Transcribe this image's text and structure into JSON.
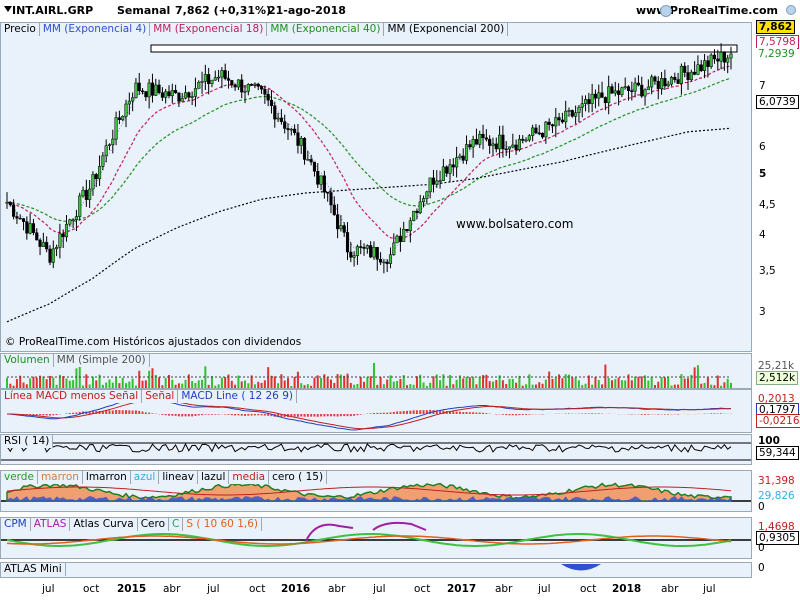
{
  "header": {
    "ticker": "INT.AIRL.GRP",
    "period": "Semanal",
    "quote": "7,862 (+0,31%)",
    "date": "21-ago-2018",
    "site": "www.ProRealTime.com"
  },
  "price_panel": {
    "legend": [
      "Precio",
      "MM (Exponencial 4)",
      "MM (Exponencial 18)",
      "MM (Exponencial 40)",
      "MM (Exponencial 200)"
    ],
    "legend_colors": [
      "#000000",
      "#3050d0",
      "#c02060",
      "#209020",
      "#000000"
    ],
    "watermark": "www.bolsatero.com",
    "footer": "© ProRealTime.com Históricos ajustados con dividendos",
    "axis_ticks": [
      "7",
      "6",
      "5",
      "4,5",
      "4",
      "3,5",
      "3"
    ],
    "labels": {
      "last": "7,862",
      "ema18": "7,5798",
      "ema40": "7,2939",
      "ema200": "6,0739"
    }
  },
  "volume_panel": {
    "legend": [
      "Volumen",
      "MM (Simple 200)"
    ],
    "labels": [
      "25,21k",
      "2,512k"
    ]
  },
  "macd_panel": {
    "legend": [
      "Línea MACD menos Señal",
      "Señal",
      "MACD Line ( 12 26 9)"
    ],
    "labels": [
      "0,2013",
      "0,1797",
      "-0,0216"
    ]
  },
  "rsi_panel": {
    "legend": [
      "RSI ( 14)"
    ],
    "labels": [
      "100",
      "59,344"
    ]
  },
  "color_panel": {
    "legend": [
      "verde",
      "marron",
      "lmarron",
      "azul",
      "lineav",
      "lazul",
      "media",
      "cero ( 15)"
    ],
    "labels": [
      "31,398",
      "29,826",
      "0"
    ]
  },
  "cpm_panel": {
    "legend": [
      "CPM",
      "ATLAS",
      "Atlas Curva",
      "Cero",
      "C",
      "S ( 10 60 1,6)"
    ],
    "labels": [
      "1,4698",
      "0,9305",
      "0"
    ]
  },
  "atlas_panel": {
    "legend": [
      "ATLAS Mini"
    ],
    "labels": [
      "0"
    ]
  },
  "x_axis": [
    {
      "label": "jul",
      "bold": false
    },
    {
      "label": "oct",
      "bold": false
    },
    {
      "label": "2015",
      "bold": true
    },
    {
      "label": "abr",
      "bold": false
    },
    {
      "label": "jul",
      "bold": false
    },
    {
      "label": "oct",
      "bold": false
    },
    {
      "label": "2016",
      "bold": true
    },
    {
      "label": "abr",
      "bold": false
    },
    {
      "label": "jul",
      "bold": false
    },
    {
      "label": "oct",
      "bold": false
    },
    {
      "label": "2017",
      "bold": true
    },
    {
      "label": "abr",
      "bold": false
    },
    {
      "label": "jul",
      "bold": false
    },
    {
      "label": "oct",
      "bold": false
    },
    {
      "label": "2018",
      "bold": true
    },
    {
      "label": "abr",
      "bold": false
    },
    {
      "label": "jul",
      "bold": false
    }
  ],
  "chart_data": {
    "type": "line",
    "title": "INT.AIRL.GRP",
    "x": [
      "2014-07",
      "2014-10",
      "2015-01",
      "2015-04",
      "2015-07",
      "2015-10",
      "2016-01",
      "2016-04",
      "2016-07",
      "2016-10",
      "2017-01",
      "2017-04",
      "2017-07",
      "2017-10",
      "2018-01",
      "2018-04",
      "2018-07",
      "2018-08"
    ],
    "series": [
      {
        "name": "Precio",
        "values": [
          4.7,
          3.9,
          5.0,
          7.0,
          6.8,
          7.3,
          6.8,
          5.6,
          4.0,
          3.9,
          5.1,
          5.8,
          5.8,
          6.2,
          6.8,
          7.0,
          7.4,
          7.862
        ]
      },
      {
        "name": "MM (Exponencial 200)",
        "values": [
          3.1,
          3.3,
          3.6,
          4.0,
          4.3,
          4.55,
          4.75,
          4.85,
          4.9,
          4.95,
          5.0,
          5.1,
          5.25,
          5.4,
          5.6,
          5.8,
          6.0,
          6.0739
        ]
      }
    ],
    "ylim": [
      2.9,
      8.0
    ],
    "ylabel": "",
    "last": 7.862
  }
}
